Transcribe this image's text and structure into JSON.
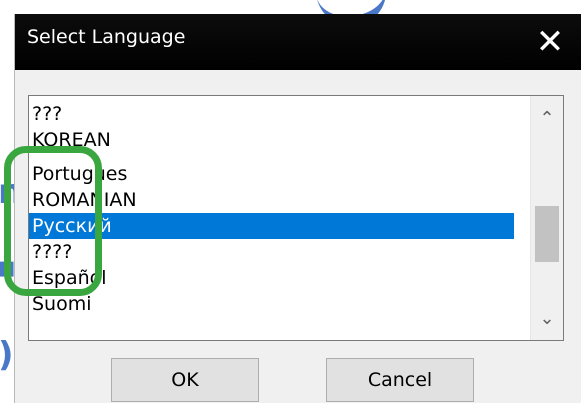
{
  "dialog": {
    "title": "Select Language",
    "close_icon": "close-icon"
  },
  "list": {
    "items": [
      {
        "label": "???",
        "selected": false
      },
      {
        "label": "KOREAN",
        "selected": false
      },
      {
        "label": "Portugues",
        "selected": false
      },
      {
        "label": "ROMANIAN",
        "selected": false
      },
      {
        "label": "Русский",
        "selected": true
      },
      {
        "label": "????",
        "selected": false
      },
      {
        "label": "Español",
        "selected": false
      },
      {
        "label": "Suomi",
        "selected": false
      }
    ]
  },
  "buttons": {
    "ok_label": "OK",
    "cancel_label": "Cancel"
  },
  "colors": {
    "selection": "#0078d7",
    "highlight": "#3aa640",
    "titlebar": "#000000"
  }
}
